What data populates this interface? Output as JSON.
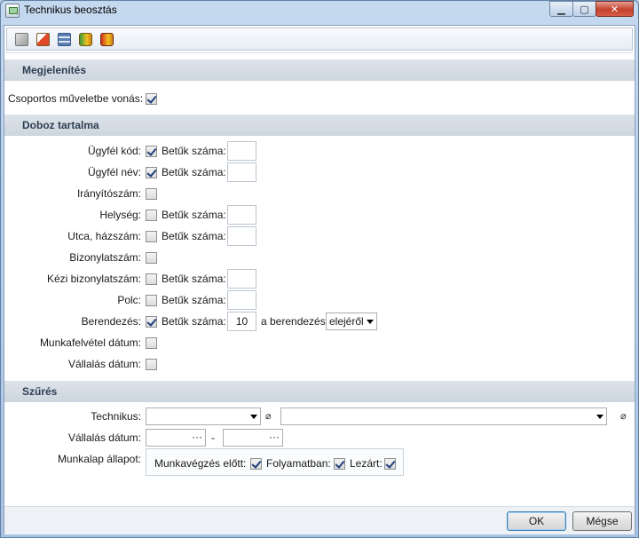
{
  "window": {
    "title": "Technikus beosztás"
  },
  "sections": {
    "display": {
      "title": "Megjelenítés",
      "group_action_label": "Csoportos műveletbe vonás:",
      "group_action_checked": true
    },
    "box": {
      "title": "Doboz tartalma",
      "letters_label": "Betűk száma:",
      "rows": {
        "client_code": {
          "label": "Ügyfél kód:",
          "checked": true,
          "letters": ""
        },
        "client_name": {
          "label": "Ügyfél név:",
          "checked": true,
          "letters": ""
        },
        "zip": {
          "label": "Irányítószám:",
          "checked": false
        },
        "city": {
          "label": "Helység:",
          "checked": false,
          "letters": ""
        },
        "street": {
          "label": "Utca, házszám:",
          "checked": false,
          "letters": ""
        },
        "doc_no": {
          "label": "Bizonylatszám:",
          "checked": false
        },
        "manual_doc_no": {
          "label": "Kézi bizonylatszám:",
          "checked": false,
          "letters": ""
        },
        "shelf": {
          "label": "Polc:",
          "checked": false,
          "letters": ""
        },
        "device": {
          "label": "Berendezés:",
          "checked": true,
          "letters": "10",
          "suffix": "a berendezés",
          "position": "elejéről"
        },
        "intake_date": {
          "label": "Munkafelvétel dátum:",
          "checked": false
        },
        "accept_date": {
          "label": "Vállalás dátum:",
          "checked": false
        }
      }
    },
    "filter": {
      "title": "Szűrés",
      "technician_label": "Technikus:",
      "technician_value": "",
      "technician_name_value": "",
      "accept_date_label": "Vállalás dátum:",
      "date_from": "",
      "date_to": "",
      "date_sep": "-",
      "ellipsis": "···",
      "status_label": "Munkalap állapot:",
      "status_before_label": "Munkavégzés előtt:",
      "status_before_checked": true,
      "status_in_progress_label": "Folyamatban:",
      "status_in_progress_checked": true,
      "status_closed_label": "Lezárt:",
      "status_closed_checked": true
    }
  },
  "buttons": {
    "ok": "OK",
    "cancel": "Mégse"
  },
  "icons": {
    "toolbar": [
      "copy-icon",
      "edit-icon",
      "calculator-icon",
      "database-add-icon",
      "database-remove-icon"
    ],
    "attach": "paperclip-icon"
  }
}
